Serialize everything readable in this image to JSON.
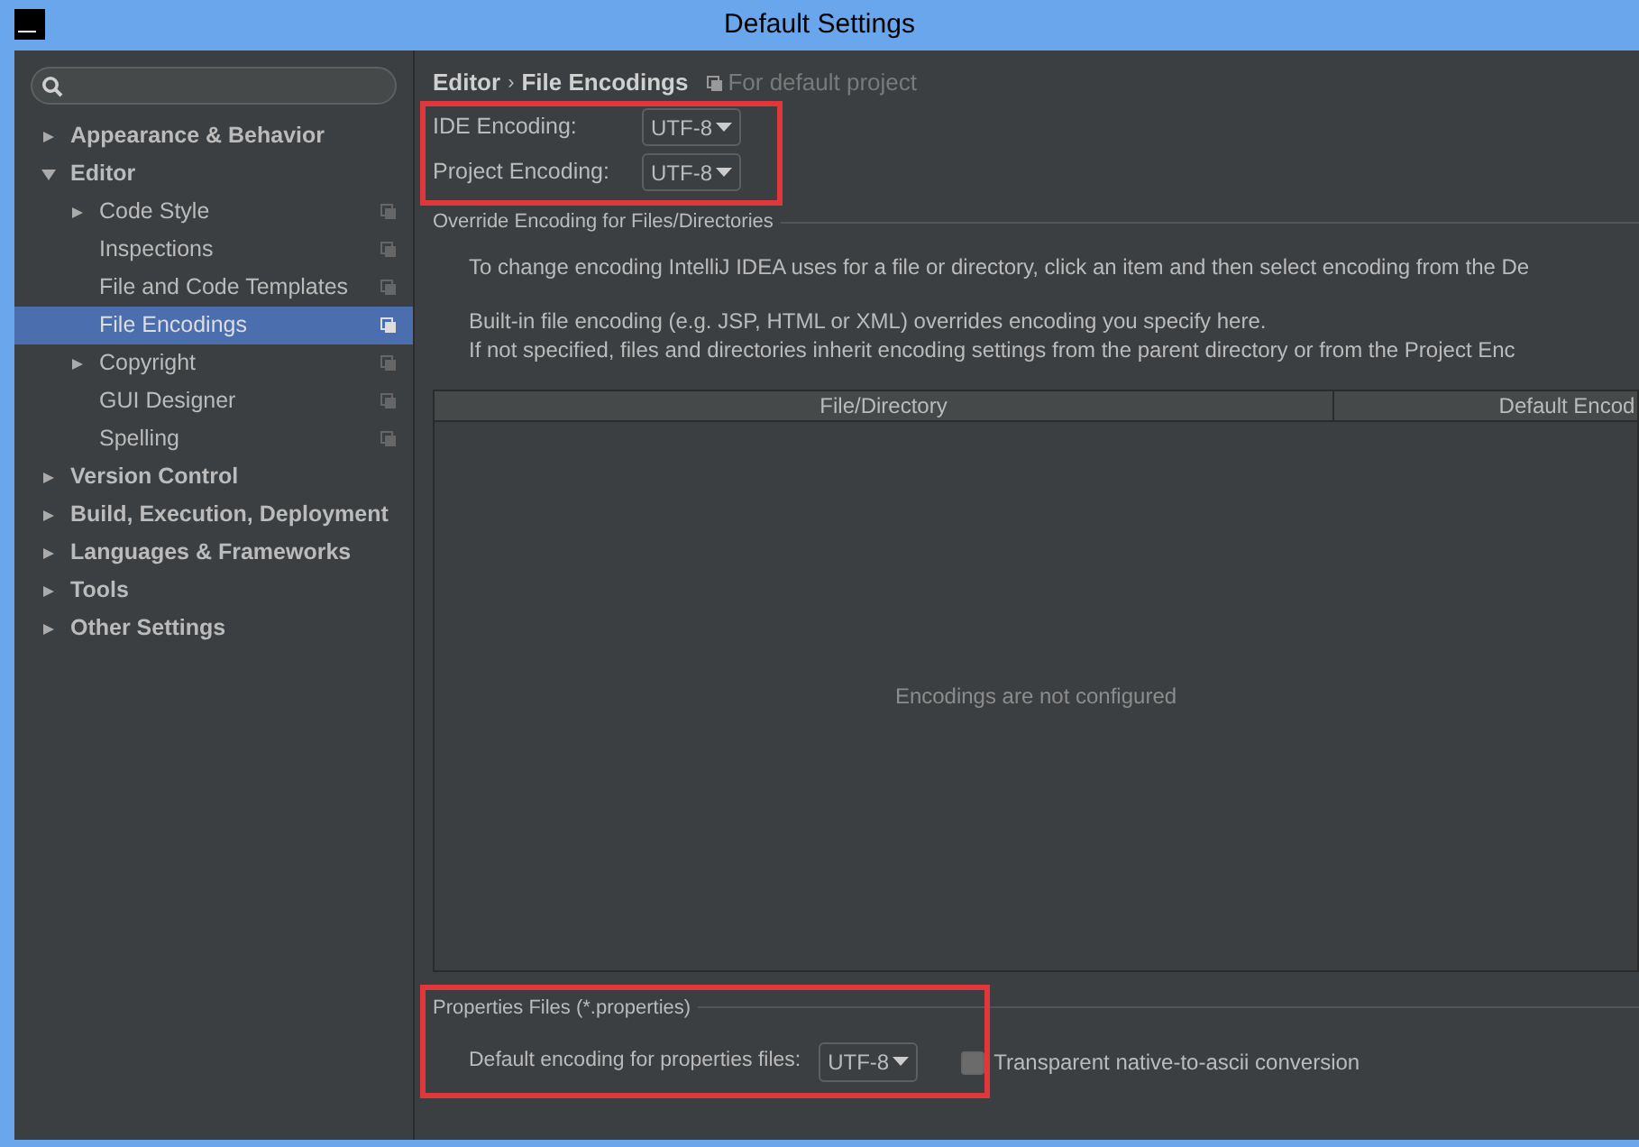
{
  "window": {
    "title": "Default Settings"
  },
  "sidebar": {
    "items": [
      {
        "label": "Appearance & Behavior",
        "expanded": false,
        "selected": false
      },
      {
        "label": "Editor",
        "expanded": true,
        "selected": false,
        "children": [
          {
            "label": "Code Style",
            "expanded": false,
            "selected": false,
            "project_icon": true
          },
          {
            "label": "Inspections",
            "selected": false,
            "project_icon": true
          },
          {
            "label": "File and Code Templates",
            "selected": false,
            "project_icon": true
          },
          {
            "label": "File Encodings",
            "selected": true,
            "project_icon": true
          },
          {
            "label": "Copyright",
            "expanded": false,
            "selected": false,
            "project_icon": true
          },
          {
            "label": "GUI Designer",
            "selected": false,
            "project_icon": true
          },
          {
            "label": "Spelling",
            "selected": false,
            "project_icon": true
          }
        ]
      },
      {
        "label": "Version Control",
        "expanded": false,
        "selected": false
      },
      {
        "label": "Build, Execution, Deployment",
        "expanded": false,
        "selected": false
      },
      {
        "label": "Languages & Frameworks",
        "expanded": false,
        "selected": false
      },
      {
        "label": "Tools",
        "expanded": false,
        "selected": false
      },
      {
        "label": "Other Settings",
        "expanded": false,
        "selected": false
      }
    ]
  },
  "breadcrumb": {
    "parent": "Editor",
    "separator": "›",
    "current": "File Encodings",
    "scope": "For default project"
  },
  "encodings": [
    {
      "label": "IDE Encoding:",
      "value": "UTF-8"
    },
    {
      "label": "Project Encoding:",
      "value": "UTF-8"
    }
  ],
  "override": {
    "title": "Override Encoding for Files/Directories",
    "paragraphs": [
      "To change encoding IntelliJ IDEA uses for a file or directory, click an item and then select encoding from the De",
      "Built-in file encoding (e.g. JSP, HTML or XML) overrides encoding you specify here.\nIf not specified, files and directories inherit encoding settings from the parent directory or from the Project Enc"
    ],
    "table": {
      "columns": [
        "File/Directory",
        "Default Encod"
      ],
      "empty_text": "Encodings are not configured"
    }
  },
  "properties": {
    "title": "Properties Files (*.properties)",
    "label": "Default encoding for properties files:",
    "value": "UTF-8",
    "checkbox": {
      "label": "Transparent native-to-ascii conversion",
      "checked": false
    }
  }
}
